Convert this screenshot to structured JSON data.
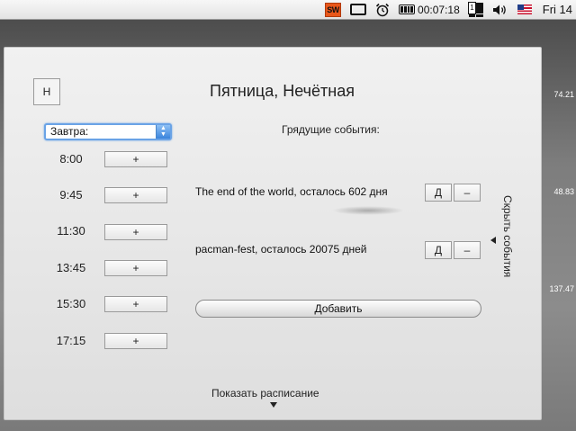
{
  "menubar": {
    "sw_label": "SW",
    "battery_time": "00:07:18",
    "spaces_number": "1",
    "clock": "Fri 14"
  },
  "desktop": {
    "side_numbers": [
      "74.21",
      "48.83",
      "137.47"
    ]
  },
  "panel": {
    "h_button": "Н",
    "title": "Пятница, Нечётная",
    "select_value": "Завтра:",
    "schedule": [
      {
        "time": "8:00",
        "button": "+"
      },
      {
        "time": "9:45",
        "button": "+"
      },
      {
        "time": "11:30",
        "button": "+"
      },
      {
        "time": "13:45",
        "button": "+"
      },
      {
        "time": "15:30",
        "button": "+"
      },
      {
        "time": "17:15",
        "button": "+"
      }
    ],
    "events_heading": "Грядущие события:",
    "events": [
      {
        "text": "The end of the world, осталось 602 дня",
        "d_button": "Д",
        "minus_button": "–"
      },
      {
        "text": "pacman-fest, осталось 20075 дней",
        "d_button": "Д",
        "minus_button": "–"
      }
    ],
    "add_button": "Добавить",
    "hide_events": "Скрыть события",
    "show_schedule": "Показать расписание"
  },
  "colors": {
    "sw_icon": "#e8571a",
    "select_focus": "#6aa3e6",
    "panel_bg": "#e8e8e8"
  }
}
